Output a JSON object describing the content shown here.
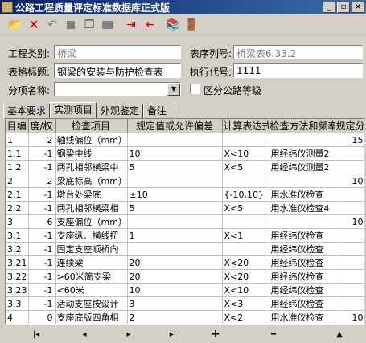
{
  "window": {
    "title": "公路工程质量评定标准数据库正式版"
  },
  "toolbar": {
    "icons": [
      "open-folder-icon",
      "delete-x-icon",
      "undo-icon",
      "stop-icon",
      "copy-icon",
      "paste-icon",
      "import-icon",
      "export-icon",
      "books-icon",
      "exit-door-icon"
    ]
  },
  "form": {
    "category_label": "工程类别:",
    "category_value": "桥梁",
    "serial_label": "表序列号:",
    "serial_value": "桥梁表6.33.2",
    "title_label": "表格标题:",
    "title_value": "钢梁的安装与防护检查表",
    "code_label": "执行代号:",
    "code_value": "1111",
    "subitem_label": "分项名称:",
    "subitem_value": "",
    "grade_label": "区分公路等级"
  },
  "tabs": [
    "基本要求",
    "实测项目",
    "外观鉴定",
    "备注"
  ],
  "table": {
    "headers": [
      "目编",
      "度/权",
      "检查项目",
      "规定值或允许偏差",
      "计算表达式",
      "检查方法和频率",
      "规定分"
    ],
    "rows": [
      [
        "1",
        "2",
        "轴线偏位（mm）",
        "",
        "",
        "",
        "15"
      ],
      [
        "1.1",
        "-1",
        "钢梁中线",
        "10",
        "X<10",
        "用经纬仪测量2",
        ""
      ],
      [
        "1.2",
        "-1",
        "两孔相邻横梁中",
        "5",
        "X<5",
        "用经纬仪测量2",
        ""
      ],
      [
        "2",
        "2",
        "梁底标高（mm）",
        "",
        "",
        "",
        "10"
      ],
      [
        "2.1",
        "-1",
        "墩台处梁底",
        "±10",
        "{-10,10}",
        "用水准仪检查",
        ""
      ],
      [
        "2.2",
        "-1",
        "两孔相邻横梁相",
        "5",
        "X<5",
        "用水准仪检查4",
        ""
      ],
      [
        "3",
        "6",
        "支座偏位（mm）",
        "",
        "",
        "",
        "10"
      ],
      [
        "3.1",
        "-1",
        "支座纵、横线扭",
        "1",
        "X<1",
        "用经纬仪检查",
        ""
      ],
      [
        "3.2",
        "-1",
        "固定支座顺桥向",
        "",
        "",
        "用经纬仪检查",
        ""
      ],
      [
        "3.21",
        "-1",
        "连续梁",
        "20",
        "X<20",
        "用经纬仪检查",
        ""
      ],
      [
        "3.22",
        "-1",
        ">60米简支梁",
        "20",
        "X<20",
        "用经纬仪检查",
        ""
      ],
      [
        "3.23",
        "-1",
        "<60米",
        "10",
        "X<10",
        "用经纬仪检查",
        ""
      ],
      [
        "3.3",
        "-1",
        "活动支座按设计",
        "3",
        "X<3",
        "用经纬仪检查",
        ""
      ],
      [
        "4",
        "0",
        "支座底版四角相",
        "2",
        "X<2",
        "用水准仪检查",
        "10"
      ]
    ]
  },
  "navigator": {
    "first": "|◂",
    "prior": "◂",
    "next": "▸",
    "last": "▸|",
    "insert": "+",
    "delete": "━",
    "edit": "▲"
  }
}
